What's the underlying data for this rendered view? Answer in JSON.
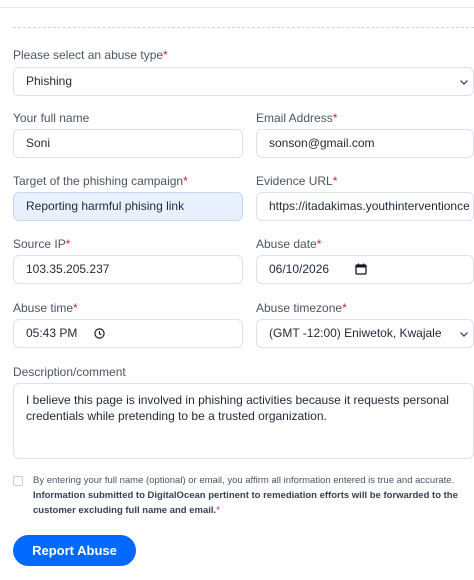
{
  "form": {
    "abuse_type": {
      "label": "Please select an abuse type",
      "value": "Phishing"
    },
    "full_name": {
      "label": "Your full name",
      "value": "Soni"
    },
    "email": {
      "label": "Email Address",
      "value": "sonson@gmail.com"
    },
    "target": {
      "label": "Target of the phishing campaign",
      "value": "Reporting harmful phising link"
    },
    "evidence_url": {
      "label": "Evidence URL",
      "value": "https://itadakimas.youthinterventionce"
    },
    "source_ip": {
      "label": "Source IP",
      "value": "103.35.205.237"
    },
    "abuse_date": {
      "label": "Abuse date",
      "value": "06/10/2026"
    },
    "abuse_time": {
      "label": "Abuse time",
      "value": "05:43 PM"
    },
    "abuse_timezone": {
      "label": "Abuse timezone",
      "value": "(GMT -12:00) Eniwetok, Kwajale"
    },
    "description": {
      "label": "Description/comment",
      "value": "I believe this page is involved in phishing activities because it requests personal credentials while pretending to be a trusted organization."
    },
    "consent": {
      "text_plain": "By entering your full name (optional) or email, you affirm all information entered is true and accurate.",
      "text_bold": "Information submitted to DigitalOcean pertinent to remediation efforts will be forwarded to the customer excluding full name and email."
    },
    "required_mark": "*",
    "submit_label": "Report Abuse"
  },
  "colors": {
    "accent": "#0069ff",
    "required": "#e11d48",
    "filled_bg": "#e8effd"
  },
  "icons": {
    "select": "chevron-down-icon",
    "date": "calendar-icon",
    "time": "clock-icon"
  }
}
